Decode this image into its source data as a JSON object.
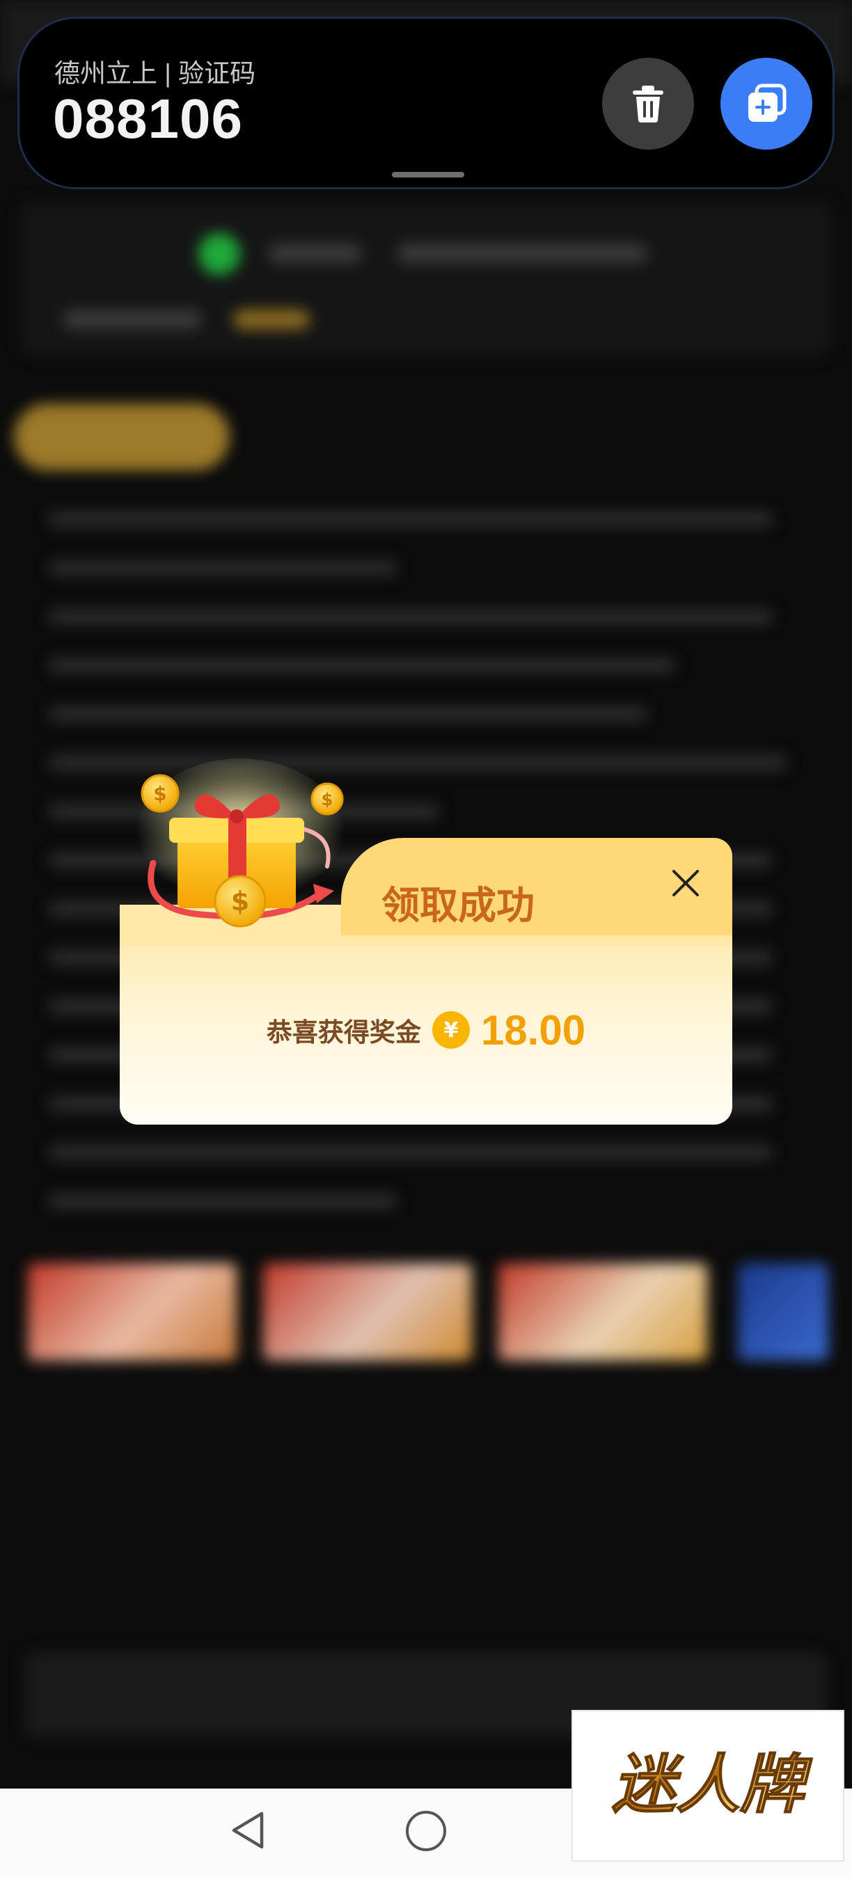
{
  "notification": {
    "title": "德州立上 | 验证码",
    "code": "088106",
    "icons": {
      "delete": "trash-icon",
      "copy": "copy-add-icon"
    }
  },
  "popup": {
    "title": "领取成功",
    "reward_label": "恭喜获得奖金",
    "currency_symbol": "¥",
    "reward_amount": "18.00",
    "icons": {
      "close": "close-icon",
      "illustration": "gift-box-coins-illustration"
    }
  },
  "watermark": {
    "text": "迷人牌"
  },
  "navbar": {
    "icons": [
      "back-triangle-icon",
      "home-circle-icon"
    ]
  },
  "colors": {
    "accent_blue": "#3b7df4",
    "popup_title": "#c8661a",
    "reward_amount": "#f3a100",
    "reward_label": "#7a4a24"
  }
}
